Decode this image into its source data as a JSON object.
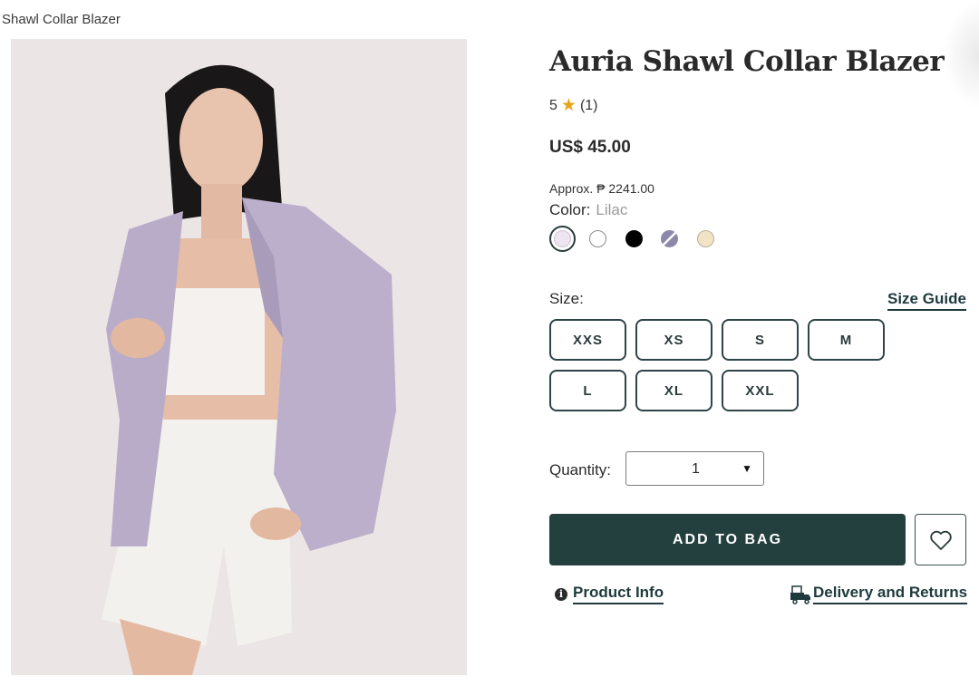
{
  "breadcrumb": {
    "current": "Shawl Collar Blazer"
  },
  "product": {
    "title": "Auria Shawl Collar Blazer",
    "rating_value": "5",
    "rating_count": "(1)",
    "price": "US$ 45.00",
    "approx_price": "Approx. ₱ 2241.00",
    "color_label": "Color:",
    "color_value": "Lilac",
    "swatch_colors": [
      "#efe4f2",
      "#ffffff",
      "#000000",
      "#8c88a9",
      "#f0e3c6"
    ]
  },
  "size": {
    "label": "Size:",
    "guide_label": "Size Guide",
    "options": [
      "XXS",
      "XS",
      "S",
      "M",
      "L",
      "XL",
      "XXL"
    ]
  },
  "quantity": {
    "label": "Quantity:",
    "value": "1"
  },
  "actions": {
    "add_to_bag": "ADD TO BAG",
    "product_info": "Product Info",
    "delivery_returns": "Delivery and Returns"
  },
  "colors": {
    "accent": "#23403f",
    "star": "#e9a317"
  }
}
